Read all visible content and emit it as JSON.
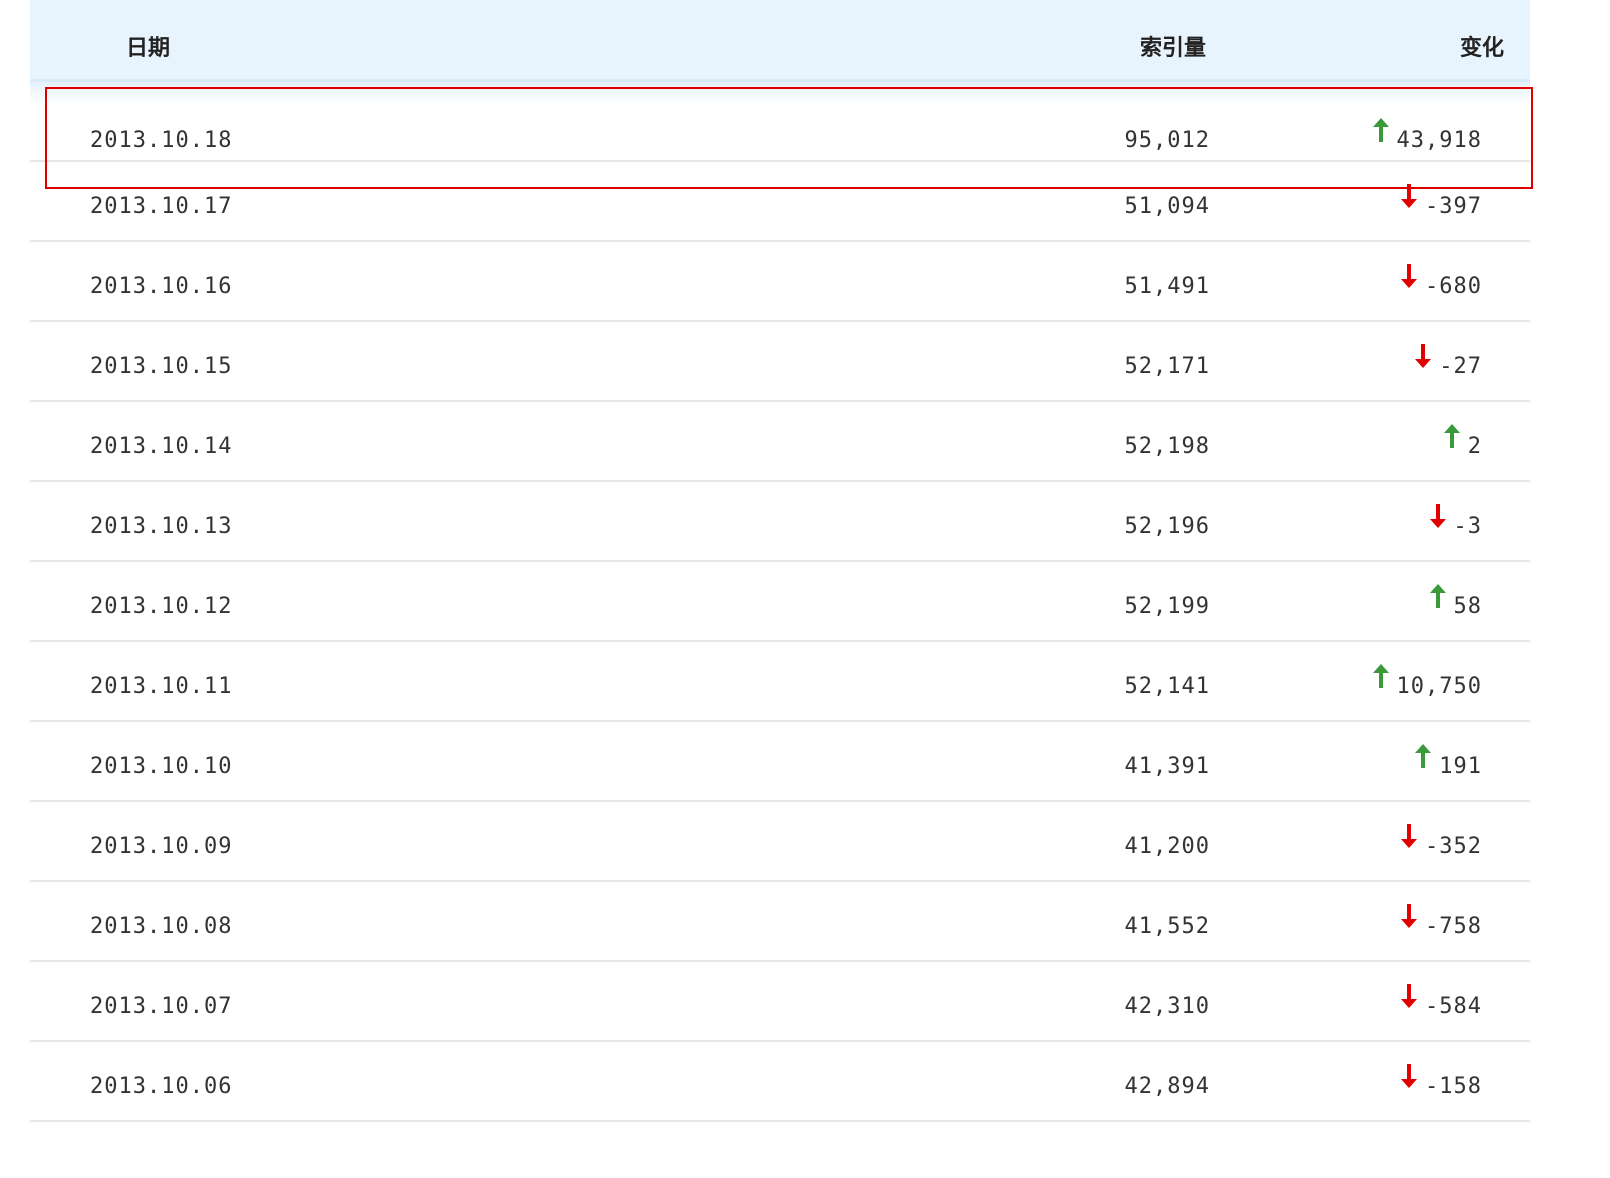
{
  "table": {
    "headers": {
      "date": "日期",
      "index": "索引量",
      "change": "变化"
    },
    "rows": [
      {
        "date": "2013.10.18",
        "index": "95,012",
        "change": "43,918",
        "direction": "up"
      },
      {
        "date": "2013.10.17",
        "index": "51,094",
        "change": "-397",
        "direction": "down"
      },
      {
        "date": "2013.10.16",
        "index": "51,491",
        "change": "-680",
        "direction": "down"
      },
      {
        "date": "2013.10.15",
        "index": "52,171",
        "change": "-27",
        "direction": "down"
      },
      {
        "date": "2013.10.14",
        "index": "52,198",
        "change": "2",
        "direction": "up"
      },
      {
        "date": "2013.10.13",
        "index": "52,196",
        "change": "-3",
        "direction": "down"
      },
      {
        "date": "2013.10.12",
        "index": "52,199",
        "change": "58",
        "direction": "up"
      },
      {
        "date": "2013.10.11",
        "index": "52,141",
        "change": "10,750",
        "direction": "up"
      },
      {
        "date": "2013.10.10",
        "index": "41,391",
        "change": "191",
        "direction": "up"
      },
      {
        "date": "2013.10.09",
        "index": "41,200",
        "change": "-352",
        "direction": "down"
      },
      {
        "date": "2013.10.08",
        "index": "41,552",
        "change": "-758",
        "direction": "down"
      },
      {
        "date": "2013.10.07",
        "index": "42,310",
        "change": "-584",
        "direction": "down"
      },
      {
        "date": "2013.10.06",
        "index": "42,894",
        "change": "-158",
        "direction": "down"
      }
    ]
  },
  "icons": {
    "up": "arrow-up-icon",
    "down": "arrow-down-icon"
  },
  "colors": {
    "up": "#3a9a3a",
    "down": "#e00000",
    "header_bg": "#e8f4fd",
    "highlight_border": "#e00000"
  }
}
